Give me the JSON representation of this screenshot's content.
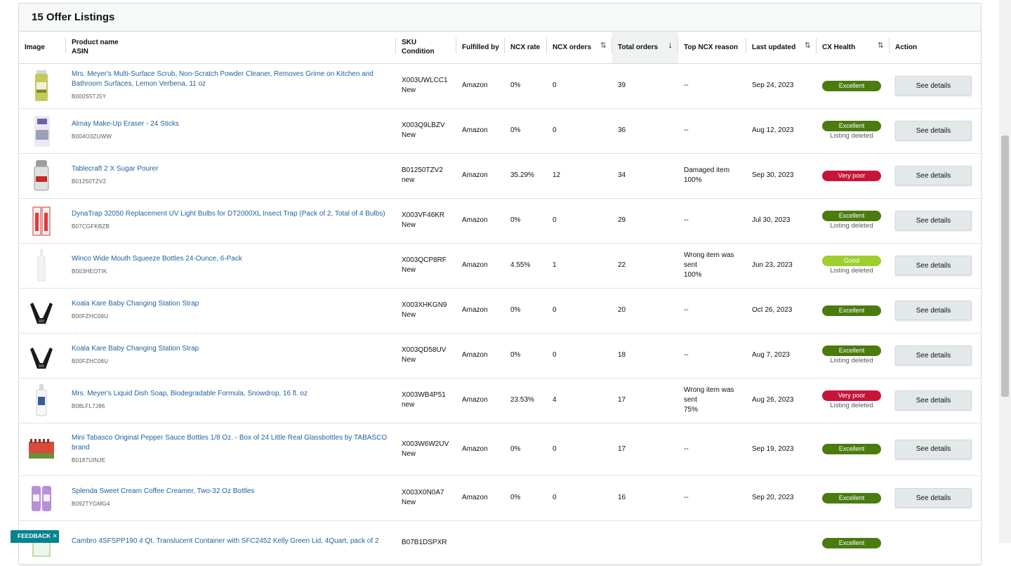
{
  "panel": {
    "title": "15 Offer Listings"
  },
  "columns": {
    "image": "Image",
    "product_name": "Product name",
    "asin": "ASIN",
    "sku": "SKU",
    "condition": "Condition",
    "fulfilled_by": "Fulfilled by",
    "ncx_rate": "NCX rate",
    "ncx_orders": "NCX orders",
    "total_orders": "Total orders",
    "top_ncx_reason": "Top NCX reason",
    "last_updated": "Last updated",
    "cx_health": "CX Health",
    "action": "Action"
  },
  "rows": [
    {
      "name": "Mrs. Meyer's Multi-Surface Scrub, Non-Scratch Powder Cleaner, Removes Grime on Kitchen and Bathroom Surfaces, Lemon Verbena, 11 oz",
      "asin": "B000S5TJ5Y",
      "sku": "X003UWLCC1",
      "condition": "New",
      "fulfilled": "Amazon",
      "ncx_rate": "0%",
      "ncx_orders": "0",
      "total": "39",
      "reason": [
        "--"
      ],
      "updated": "Sep 24, 2023",
      "health": "Excellent",
      "health_class": "excellent",
      "deleted": "",
      "action": "See details",
      "image": "can-icon"
    },
    {
      "name": "Almay Make-Up Eraser - 24 Sticks",
      "asin": "B004O3ZUWW",
      "sku": "X003Q9LBZV",
      "condition": "New",
      "fulfilled": "Amazon",
      "ncx_rate": "0%",
      "ncx_orders": "0",
      "total": "36",
      "reason": [
        "--"
      ],
      "updated": "Aug 12, 2023",
      "health": "Excellent",
      "health_class": "excellent",
      "deleted": "Listing deleted",
      "action": "See details",
      "image": "package-icon"
    },
    {
      "name": "Tablecraft 2 X Sugar Pourer",
      "asin": "B01250TZV2",
      "sku": "B01250TZV2",
      "condition": "new",
      "fulfilled": "Amazon",
      "ncx_rate": "35.29%",
      "ncx_orders": "12",
      "total": "34",
      "reason": [
        "Damaged item",
        "100%"
      ],
      "updated": "Sep 30, 2023",
      "health": "Very poor",
      "health_class": "verypoor",
      "deleted": "",
      "action": "See details",
      "image": "jar-icon"
    },
    {
      "name": "DynaTrap 32050 Replacement UV Light Bulbs for DT2000XL Insect Trap (Pack of 2, Total of 4 Bulbs)",
      "asin": "B07CGFKBZB",
      "sku": "X003VF46KR",
      "condition": "New",
      "fulfilled": "Amazon",
      "ncx_rate": "0%",
      "ncx_orders": "0",
      "total": "29",
      "reason": [
        "--"
      ],
      "updated": "Jul 30, 2023",
      "health": "Excellent",
      "health_class": "excellent",
      "deleted": "Listing deleted",
      "action": "See details",
      "image": "bulbs-icon"
    },
    {
      "name": "Winco Wide Mouth Squeeze Bottles 24-Ounce, 6-Pack",
      "asin": "B003HEOTIK",
      "sku": "X003QCP8RF",
      "condition": "New",
      "fulfilled": "Amazon",
      "ncx_rate": "4.55%",
      "ncx_orders": "1",
      "total": "22",
      "reason": [
        "Wrong item was",
        "sent",
        "100%"
      ],
      "updated": "Jun 23, 2023",
      "health": "Good",
      "health_class": "good",
      "deleted": "Listing deleted",
      "action": "See details",
      "image": "bottle-icon"
    },
    {
      "name": "Koala Kare Baby Changing Station Strap",
      "asin": "B00FZHC06U",
      "sku": "X003XHKGN9",
      "condition": "New",
      "fulfilled": "Amazon",
      "ncx_rate": "0%",
      "ncx_orders": "0",
      "total": "20",
      "reason": [
        "--"
      ],
      "updated": "Oct 26, 2023",
      "health": "Excellent",
      "health_class": "excellent",
      "deleted": "",
      "action": "See details",
      "image": "strap-icon"
    },
    {
      "name": "Koala Kare Baby Changing Station Strap",
      "asin": "B00FZHC06U",
      "sku": "X003QD58UV",
      "condition": "New",
      "fulfilled": "Amazon",
      "ncx_rate": "0%",
      "ncx_orders": "0",
      "total": "18",
      "reason": [
        "--"
      ],
      "updated": "Aug 7, 2023",
      "health": "Excellent",
      "health_class": "excellent",
      "deleted": "Listing deleted",
      "action": "See details",
      "image": "strap-icon"
    },
    {
      "name": "Mrs. Meyer's Liquid Dish Soap, Biodegradable Formula, Snowdrop, 16 fl. oz",
      "asin": "B08LFL7J86",
      "sku": "X003WB4P51",
      "condition": "new",
      "fulfilled": "Amazon",
      "ncx_rate": "23.53%",
      "ncx_orders": "4",
      "total": "17",
      "reason": [
        "Wrong item was",
        "sent",
        "75%"
      ],
      "updated": "Aug 26, 2023",
      "health": "Very poor",
      "health_class": "verypoor",
      "deleted": "Listing deleted",
      "action": "See details",
      "image": "soap-icon"
    },
    {
      "name": "Mini Tabasco Original Pepper Sauce Bottles 1/8 Oz. - Box of 24 Little Real Glassbottles by TABASCO brand",
      "asin": "B0187UINJE",
      "sku": "X003W6W2UV",
      "condition": "New",
      "fulfilled": "Amazon",
      "ncx_rate": "0%",
      "ncx_orders": "0",
      "total": "17",
      "reason": [
        "--"
      ],
      "updated": "Sep 19, 2023",
      "health": "Excellent",
      "health_class": "excellent",
      "deleted": "",
      "action": "See details",
      "image": "sauce-box-icon",
      "tall": true
    },
    {
      "name": "Splenda Sweet Cream Coffee Creamer, Two-32 Oz Bottles",
      "asin": "B092TYGMG4",
      "sku": "X003X0N0A7",
      "condition": "New",
      "fulfilled": "Amazon",
      "ncx_rate": "0%",
      "ncx_orders": "0",
      "total": "16",
      "reason": [
        "--"
      ],
      "updated": "Sep 20, 2023",
      "health": "Excellent",
      "health_class": "excellent",
      "deleted": "",
      "action": "See details",
      "image": "creamer-icon"
    },
    {
      "name": "Cambro 4SFSPP190 4 Qt. Translucent Container with SFC2452 Kelly Green Lid, 4Quart, pack of 2",
      "asin": "",
      "sku": "B07B1DSPXR",
      "condition": "",
      "fulfilled": "",
      "ncx_rate": "",
      "ncx_orders": "",
      "total": "",
      "reason": [
        ""
      ],
      "updated": "",
      "health": "Excellent",
      "health_class": "excellent",
      "deleted": "",
      "action": "",
      "image": "container-icon"
    }
  ],
  "feedback": {
    "label": "FEEDBACK"
  }
}
